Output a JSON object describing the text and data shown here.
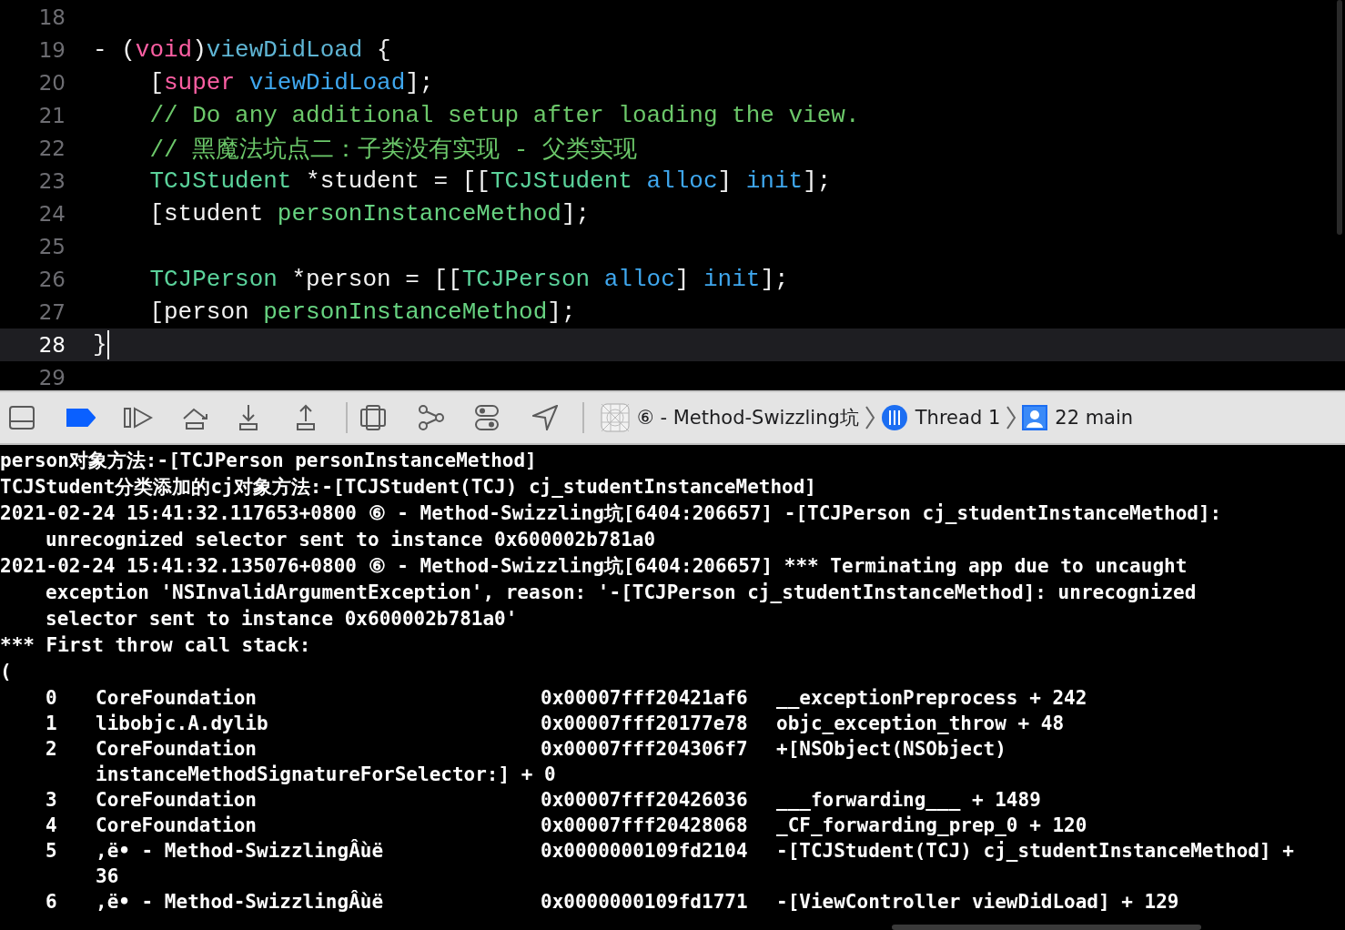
{
  "editor": {
    "lines": [
      {
        "number": "18",
        "current": false
      },
      {
        "number": "19",
        "current": false,
        "tokens": [
          {
            "kind": "plain",
            "text": "- ("
          },
          {
            "kind": "keyword",
            "text": "void"
          },
          {
            "kind": "plain",
            "text": ")"
          },
          {
            "kind": "declaration",
            "text": "viewDidLoad"
          },
          {
            "kind": "plain",
            "text": " {"
          }
        ]
      },
      {
        "number": "20",
        "current": false,
        "tokens": [
          {
            "kind": "plain",
            "text": "    ["
          },
          {
            "kind": "keyword",
            "text": "super"
          },
          {
            "kind": "method",
            "text": " viewDidLoad"
          },
          {
            "kind": "plain",
            "text": "];"
          }
        ]
      },
      {
        "number": "21",
        "current": false,
        "tokens": [
          {
            "kind": "comment",
            "text": "    // Do any additional setup after loading the view."
          }
        ]
      },
      {
        "number": "22",
        "current": false,
        "tokens": [
          {
            "kind": "comment",
            "text": "    // 黑魔法坑点二：子类没有实现 - 父类实现"
          }
        ]
      },
      {
        "number": "23",
        "current": false,
        "tokens": [
          {
            "kind": "class",
            "text": "    TCJStudent"
          },
          {
            "kind": "plain",
            "text": " *student = [["
          },
          {
            "kind": "class",
            "text": "TCJStudent"
          },
          {
            "kind": "method",
            "text": " alloc"
          },
          {
            "kind": "plain",
            "text": "] "
          },
          {
            "kind": "method",
            "text": "init"
          },
          {
            "kind": "plain",
            "text": "];"
          }
        ]
      },
      {
        "number": "24",
        "current": false,
        "tokens": [
          {
            "kind": "plain",
            "text": "    [student "
          },
          {
            "kind": "project-method",
            "text": "personInstanceMethod"
          },
          {
            "kind": "plain",
            "text": "];"
          }
        ]
      },
      {
        "number": "25",
        "current": false
      },
      {
        "number": "26",
        "current": false,
        "tokens": [
          {
            "kind": "class",
            "text": "    TCJPerson"
          },
          {
            "kind": "plain",
            "text": " *person = [["
          },
          {
            "kind": "class",
            "text": "TCJPerson"
          },
          {
            "kind": "method",
            "text": " alloc"
          },
          {
            "kind": "plain",
            "text": "] "
          },
          {
            "kind": "method",
            "text": "init"
          },
          {
            "kind": "plain",
            "text": "];"
          }
        ]
      },
      {
        "number": "27",
        "current": false,
        "tokens": [
          {
            "kind": "plain",
            "text": "    [person "
          },
          {
            "kind": "project-method",
            "text": "personInstanceMethod"
          },
          {
            "kind": "plain",
            "text": "];"
          }
        ]
      },
      {
        "number": "28",
        "current": true,
        "tokens": [
          {
            "kind": "plain",
            "text": "}"
          }
        ]
      },
      {
        "number": "29",
        "current": false
      }
    ]
  },
  "debug_bar": {
    "breakpoints_active": true,
    "breadcrumbs": [
      {
        "kind": "app",
        "label": "⑥ - Method-Swizzling坑"
      },
      {
        "kind": "thread",
        "label": "Thread 1"
      },
      {
        "kind": "frame",
        "label": "22 main"
      }
    ]
  },
  "console": {
    "log": [
      {
        "text": "person对象方法:-[TCJPerson personInstanceMethod]",
        "continuation": false
      },
      {
        "text": "TCJStudent分类添加的cj对象方法:-[TCJStudent(TCJ) cj_studentInstanceMethod]",
        "continuation": false
      },
      {
        "text": "2021-02-24 15:41:32.117653+0800 ⑥ - Method-Swizzling坑[6404:206657] -[TCJPerson cj_studentInstanceMethod]:",
        "continuation": false
      },
      {
        "text": "unrecognized selector sent to instance 0x600002b781a0",
        "continuation": true
      },
      {
        "text": "2021-02-24 15:41:32.135076+0800 ⑥ - Method-Swizzling坑[6404:206657] *** Terminating app due to uncaught",
        "continuation": false
      },
      {
        "text": "exception 'NSInvalidArgumentException', reason: '-[TCJPerson cj_studentInstanceMethod]: unrecognized",
        "continuation": true
      },
      {
        "text": "selector sent to instance 0x600002b781a0'",
        "continuation": true
      },
      {
        "text": "*** First throw call stack:",
        "continuation": false
      },
      {
        "text": "(",
        "continuation": false
      }
    ],
    "frames": [
      {
        "index": "0",
        "library": "CoreFoundation",
        "address": "0x00007fff20421af6",
        "symbol": "__exceptionPreprocess + 242"
      },
      {
        "index": "1",
        "library": "libobjc.A.dylib",
        "address": "0x00007fff20177e78",
        "symbol": "objc_exception_throw + 48"
      },
      {
        "index": "2",
        "library": "CoreFoundation",
        "address": "0x00007fff204306f7",
        "symbol": "+[NSObject(NSObject)",
        "continuation": "instanceMethodSignatureForSelector:] + 0"
      },
      {
        "index": "3",
        "library": "CoreFoundation",
        "address": "0x00007fff20426036",
        "symbol": "___forwarding___ + 1489"
      },
      {
        "index": "4",
        "library": "CoreFoundation",
        "address": "0x00007fff20428068",
        "symbol": "_CF_forwarding_prep_0 + 120"
      },
      {
        "index": "5",
        "library": ",ë• - Method-SwizzlingÂùë",
        "address": "0x0000000109fd2104",
        "symbol": "-[TCJStudent(TCJ) cj_studentInstanceMethod] +",
        "continuation": "36"
      },
      {
        "index": "6",
        "library": ",ë• - Method-SwizzlingÂùë",
        "address": "0x0000000109fd1771",
        "symbol": "-[ViewController viewDidLoad] + 129"
      }
    ]
  }
}
